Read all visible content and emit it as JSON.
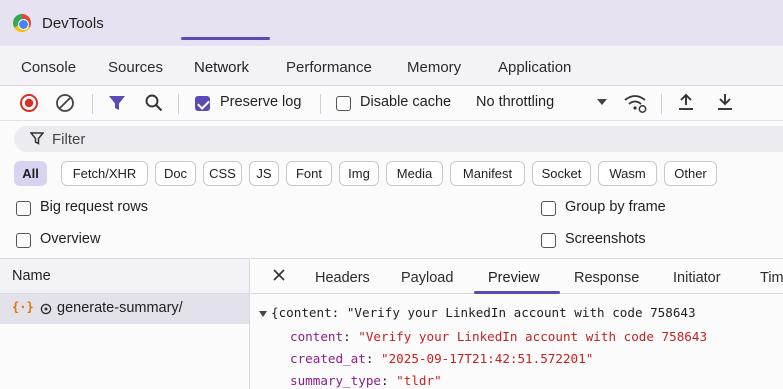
{
  "window": {
    "title": "DevTools",
    "logo": "chrome-logo-icon"
  },
  "main_tabs": [
    "Console",
    "Sources",
    "Network",
    "Performance",
    "Memory",
    "Application"
  ],
  "active_main_tab": "Network",
  "toolbar": {
    "icons": [
      "record-stop-icon",
      "clear-icon",
      "filter-funnel-icon",
      "search-icon",
      "network-conditions-icon",
      "upload-icon",
      "download-icon"
    ],
    "preserve_log": {
      "label": "Preserve log",
      "checked": true
    },
    "disable_cache": {
      "label": "Disable cache",
      "checked": false
    },
    "throttling": "No throttling"
  },
  "filter": {
    "placeholder": "Filter"
  },
  "type_filters": [
    "All",
    "Fetch/XHR",
    "Doc",
    "CSS",
    "JS",
    "Font",
    "Img",
    "Media",
    "Manifest",
    "Socket",
    "Wasm",
    "Other"
  ],
  "active_type_filter": "All",
  "options": {
    "big_request_rows": "Big request rows",
    "group_by_frame": "Group by frame",
    "overview": "Overview",
    "screenshots": "Screenshots"
  },
  "requests": {
    "header": "Name",
    "items": [
      {
        "name": "generate-summary/"
      }
    ]
  },
  "detail_tabs": [
    "Headers",
    "Payload",
    "Preview",
    "Response",
    "Initiator",
    "Tim"
  ],
  "active_detail_tab": "Preview",
  "preview": {
    "summary_line": "{content: \"Verify your LinkedIn account with code 758643",
    "fields": [
      {
        "key": "content",
        "value": "\"Verify your LinkedIn account with code 758643"
      },
      {
        "key": "created_at",
        "value": "\"2025-09-17T21:42:51.572201\""
      },
      {
        "key": "summary_type",
        "value": "\"tldr\""
      }
    ]
  },
  "colors": {
    "accent": "#5b4ab5",
    "title_bar": "#e6e2f2",
    "active_chip": "#d9d3f2",
    "record_red": "#d93025",
    "json_key": "#8b1e8b",
    "json_string": "#c5221f"
  }
}
